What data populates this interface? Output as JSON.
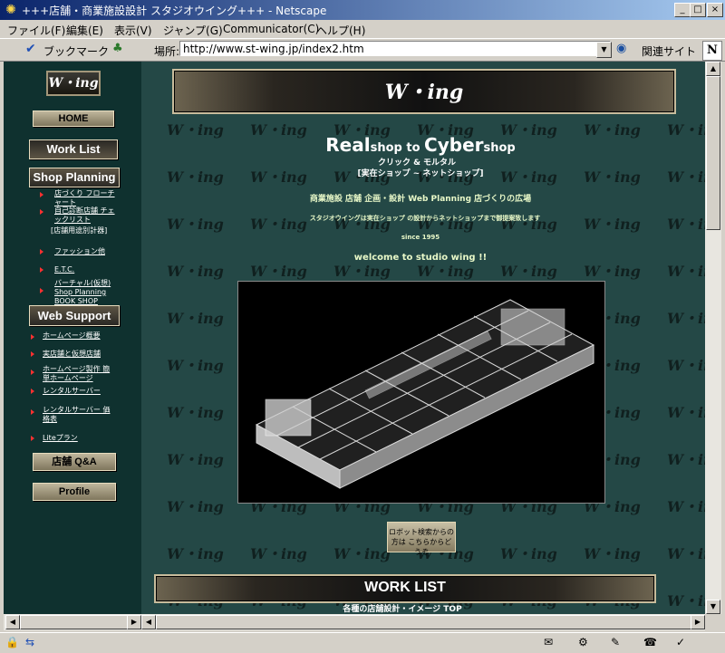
{
  "window": {
    "title": "+++店舗・商業施設設計 スタジオウイング+++ - Netscape",
    "min": "_",
    "max": "□",
    "close": "×"
  },
  "menu": [
    "ファイル(F)",
    "編集(E)",
    "表示(V)",
    "ジャンプ(G)",
    "Communicator(C)",
    "ヘルプ(H)"
  ],
  "toolbar": {
    "bookmarks": "ブックマーク",
    "location_label": "場所:",
    "url": "http://www.st-wing.jp/index2.htm",
    "related": "関連サイト",
    "logo": "N"
  },
  "sidebar": {
    "logo": "W・ing",
    "home": "HOME",
    "work_list": "Work List",
    "shop_planning": "Shop Planning",
    "shop_links": [
      {
        "label": "店づくり フローチャート"
      },
      {
        "label": "自己診断店舗 チェックリスト"
      },
      {
        "label": "[店舗用途別計器]"
      },
      {
        "label": "ファッション他"
      },
      {
        "label": "E.T.C."
      },
      {
        "label": "バーチャル(仮想) Shop Planning BOOK SHOP"
      }
    ],
    "web_support": "Web Support",
    "web_links": [
      {
        "label": "ホームページ概要"
      },
      {
        "label": "実店舗と仮想店舗"
      },
      {
        "label": "ホームページ製作 簡単ホームページ"
      },
      {
        "label": "レンタルサーバー"
      },
      {
        "label": "レンタルサーバー 価格表"
      },
      {
        "label": "Liteプラン"
      }
    ],
    "qa": "店舗 Q&A",
    "profile": "Profile"
  },
  "main": {
    "banner_logo": "W・ing",
    "watermark": "W・ing",
    "headline_real": "Real",
    "headline_shop1": "shop to ",
    "headline_cyber": "Cyber",
    "headline_shop2": "shop",
    "sub1": "クリック & モルタル",
    "sub2": "[実在ショップ ~ ネットショップ]",
    "line1": "商業施設 店舗 企画・設計 Web Planning 店づくりの広場",
    "line2": "スタジオウイングは実在ショップ の設計からネットショップまで御提案致します",
    "since": "since 1995",
    "welcome": "welcome to studio wing !!",
    "robot_btn": "ロボット検索からの方は こちらからどうぞ",
    "work_list_title": "WORK LIST",
    "work_list_sub": "各種の店舗設計・イメージ TOP"
  }
}
